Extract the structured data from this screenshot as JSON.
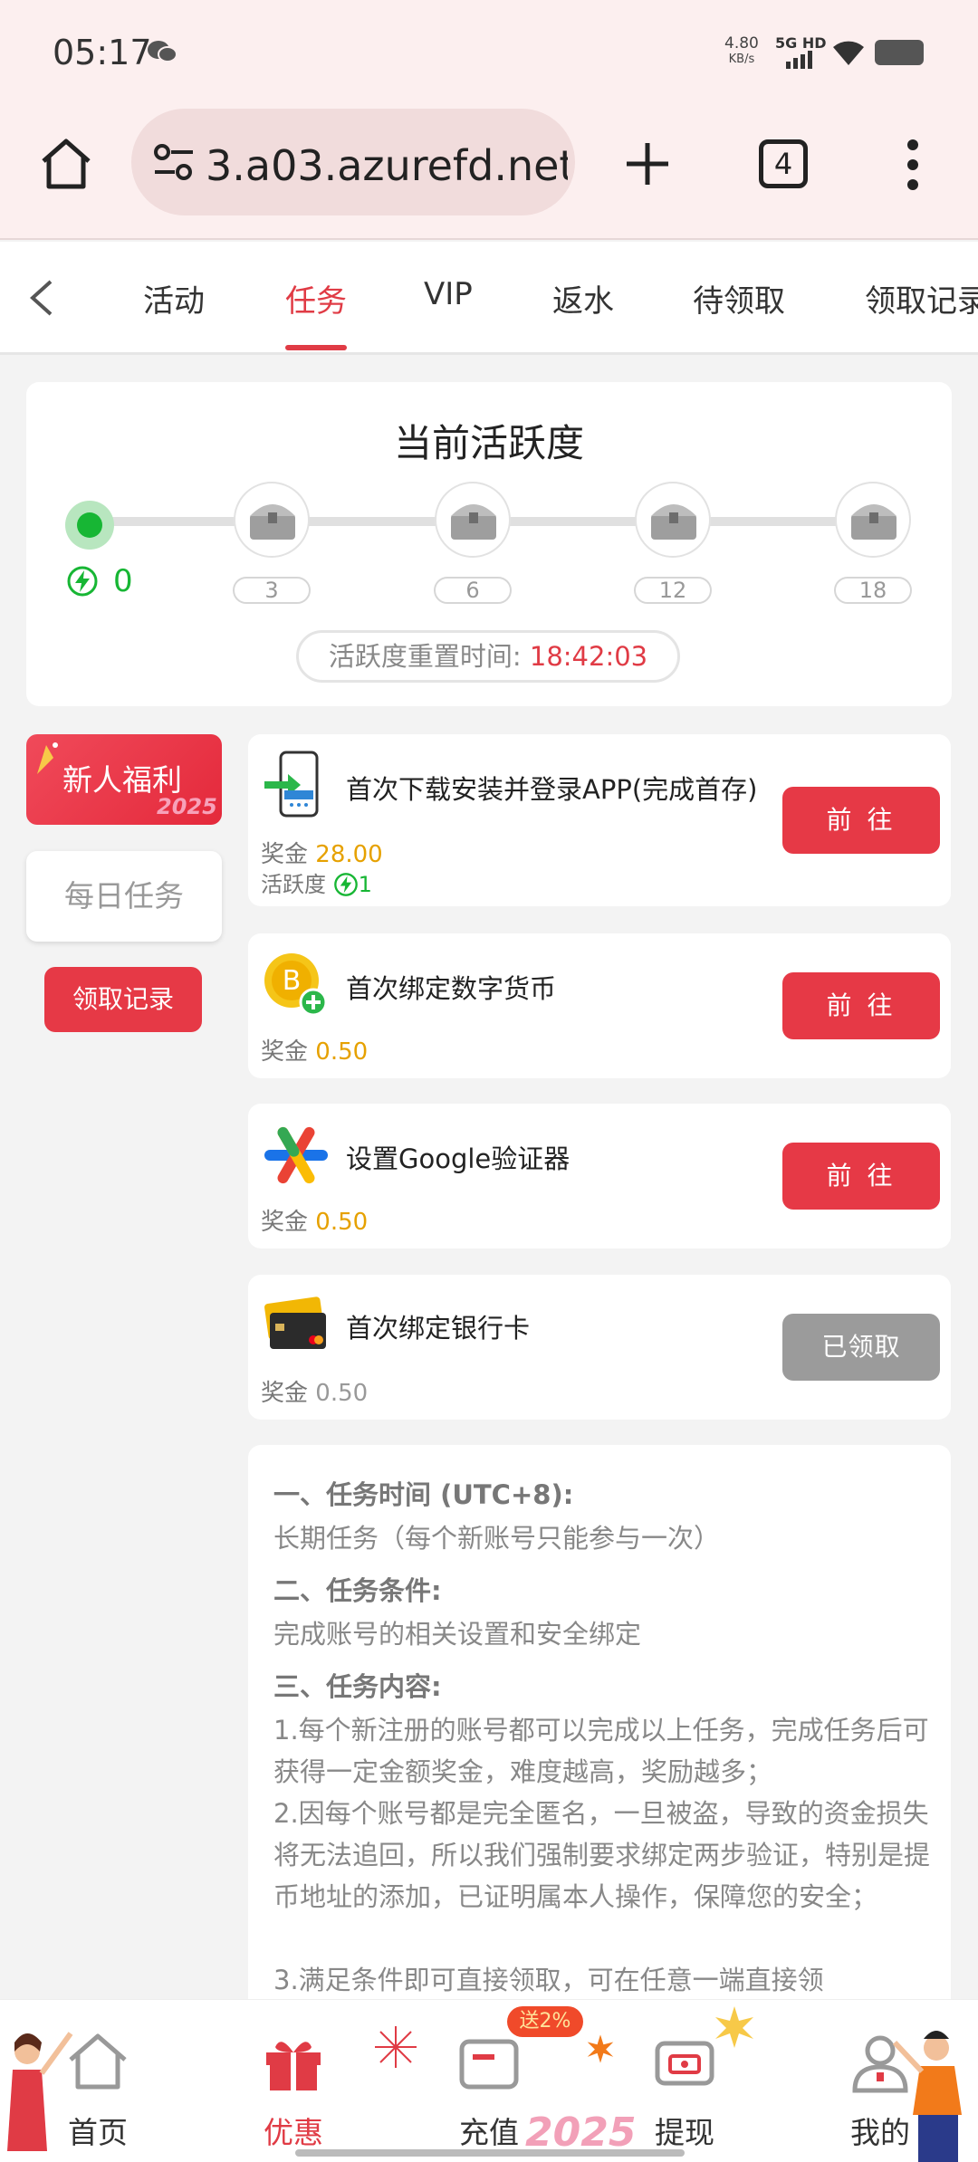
{
  "status_bar": {
    "time": "05:17",
    "net_speed_value": "4.80",
    "net_speed_unit": "KB/s",
    "signal_label": "5G HD",
    "icons": [
      "wechat-icon",
      "signal-icon",
      "wifi-icon",
      "battery-icon"
    ]
  },
  "browser": {
    "url": "3.a03.azurefd.net",
    "tab_count": "4",
    "icons": [
      "home-icon",
      "site-settings-icon",
      "new-tab-icon",
      "tabs-icon",
      "menu-icon"
    ]
  },
  "nav_tabs": {
    "items": [
      "活动",
      "任务",
      "VIP",
      "返水",
      "待领取",
      "领取记录"
    ],
    "active_index": 1,
    "accent": "#e03b45"
  },
  "activity": {
    "title": "当前活跃度",
    "current_score": "0",
    "milestones": [
      "3",
      "6",
      "12",
      "18"
    ],
    "reset_label": "活跃度重置时间: ",
    "reset_time": "18:42:03"
  },
  "side_menu": {
    "newbie": "新人福利",
    "newbie_year": "2025",
    "daily": "每日任务",
    "record_button": "领取记录"
  },
  "tasks": [
    {
      "name": "首次下载安装并登录APP(完成首存)",
      "reward_label": "奖金",
      "reward_value": "28.00",
      "score_label": "活跃度",
      "score_value": "1",
      "button": "前 往",
      "icon": "phone-download-icon"
    },
    {
      "name": "首次绑定数字货币",
      "reward_label": "奖金",
      "reward_value": "0.50",
      "button": "前 往",
      "icon": "bitcoin-icon"
    },
    {
      "name": "设置Google验证器",
      "reward_label": "奖金",
      "reward_value": "0.50",
      "button": "前 往",
      "icon": "google-authenticator-icon"
    },
    {
      "name": "首次绑定银行卡",
      "reward_label": "奖金",
      "reward_value": "0.50",
      "button": "已领取",
      "icon": "bank-card-icon"
    }
  ],
  "rules": {
    "h1": "一、任务时间 (UTC+8):",
    "p1": "长期任务（每个新账号只能参与一次）",
    "h2": "二、任务条件:",
    "p2": "完成账号的相关设置和安全绑定",
    "h3": "三、任务内容:",
    "p3": "1.每个新注册的账号都可以完成以上任务，完成任务后可获得一定金额奖金，难度越高，奖励越多；",
    "p4": "2.因每个账号都是完全匿名，一旦被盗，导致的资金损失将无法追回，所以我们强制要求绑定两步验证，特别是提币地址的添加，已证明属本人操作，保障您的安全；",
    "p5": "3.满足条件即可直接领取，可在任意一端直接领"
  },
  "bottom_nav": {
    "items": [
      "首页",
      "优惠",
      "充值",
      "提现",
      "我的"
    ],
    "active_index": 1,
    "deposit_badge": "送2%",
    "year_label": "2025"
  }
}
